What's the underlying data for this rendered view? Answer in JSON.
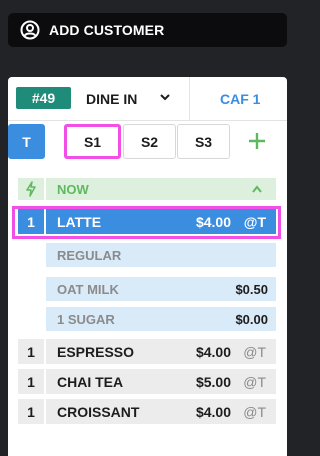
{
  "header": {
    "add_customer_label": "ADD CUSTOMER"
  },
  "order": {
    "number": "#49",
    "service_type": "DINE IN",
    "location": "CAF 1"
  },
  "seat_tabs": [
    {
      "label": "T",
      "active": true
    },
    {
      "label": "S1",
      "active": false
    },
    {
      "label": "S2",
      "active": false
    },
    {
      "label": "S3",
      "active": false
    }
  ],
  "course": {
    "label": "NOW"
  },
  "items": [
    {
      "qty": "1",
      "name": "LATTE",
      "price": "$4.00",
      "tax": "@T",
      "selected": true,
      "modifiers": [
        {
          "name": "REGULAR",
          "price": ""
        },
        {
          "name": "OAT MILK",
          "price": "$0.50"
        },
        {
          "name": "1 SUGAR",
          "price": "$0.00"
        }
      ]
    },
    {
      "qty": "1",
      "name": "ESPRESSO",
      "price": "$4.00",
      "tax": "@T",
      "selected": false
    },
    {
      "qty": "1",
      "name": "CHAI TEA",
      "price": "$5.00",
      "tax": "@T",
      "selected": false
    },
    {
      "qty": "1",
      "name": "CROISSANT",
      "price": "$4.00",
      "tax": "@T",
      "selected": false
    }
  ],
  "colors": {
    "accent_blue": "#3b8de0",
    "order_badge_green": "#1e8c78",
    "course_green": "#5fb85f",
    "highlight_magenta": "#f24fe6"
  }
}
